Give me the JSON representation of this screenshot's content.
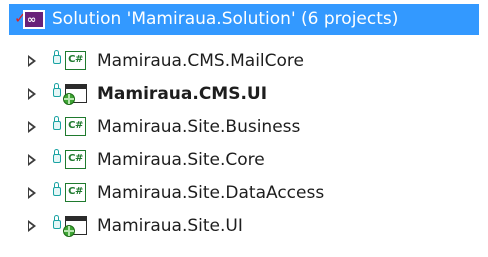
{
  "solution": {
    "label": "Solution 'Mamiraua.Solution' (6 projects)",
    "check_glyph": "✓",
    "icon": "visual-studio-solution-icon"
  },
  "projects": [
    {
      "label": "Mamiraua.CMS.MailCore",
      "type": "csharp",
      "icon_text": "C#",
      "bold": false
    },
    {
      "label": "Mamiraua.CMS.UI",
      "type": "web",
      "icon_text": "",
      "bold": true
    },
    {
      "label": "Mamiraua.Site.Business",
      "type": "csharp",
      "icon_text": "C#",
      "bold": false
    },
    {
      "label": "Mamiraua.Site.Core",
      "type": "csharp",
      "icon_text": "C#",
      "bold": false
    },
    {
      "label": "Mamiraua.Site.DataAccess",
      "type": "csharp",
      "icon_text": "C#",
      "bold": false
    },
    {
      "label": "Mamiraua.Site.UI",
      "type": "web",
      "icon_text": "",
      "bold": false
    }
  ],
  "colors": {
    "selection": "#3399ff",
    "csharp_icon": "#1f7a2e",
    "lock": "#1aa3a3",
    "check": "#e02020",
    "vs_purple": "#68217a"
  }
}
